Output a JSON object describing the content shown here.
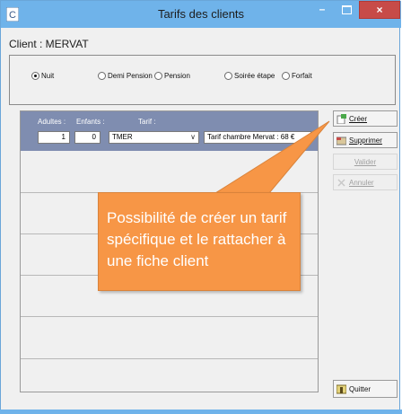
{
  "window": {
    "title": "Tarifs des clients",
    "minimize": "–",
    "close": "×"
  },
  "client": {
    "label": "Client : MERVAT"
  },
  "options": [
    {
      "label": "Nuit",
      "checked": true
    },
    {
      "label": "Demi Pension",
      "checked": false
    },
    {
      "label": "Pension",
      "checked": false
    },
    {
      "label": "Soirée étape",
      "checked": false
    },
    {
      "label": "Forfait",
      "checked": false
    }
  ],
  "grid": {
    "headers": {
      "adultes": "Adultes :",
      "enfants": "Enfants :",
      "tarif": "Tarif :"
    },
    "row": {
      "adultes": "1",
      "enfants": "0",
      "tarif": "TMER",
      "description": "Tarif chambre Mervat : 68 €"
    }
  },
  "buttons": {
    "creer": "Créer",
    "supprimer": "Supprimer",
    "valider": "Valider",
    "annuler": "Annuler",
    "quitter": "Quitter"
  },
  "callout": {
    "text": "Possibilité de créer un tarif spécifique et le rattacher à une fiche client"
  },
  "colors": {
    "titlebar": "#6fb3ea",
    "close": "#c74b48",
    "header_row": "#7f8db0",
    "callout": "#f79646"
  }
}
